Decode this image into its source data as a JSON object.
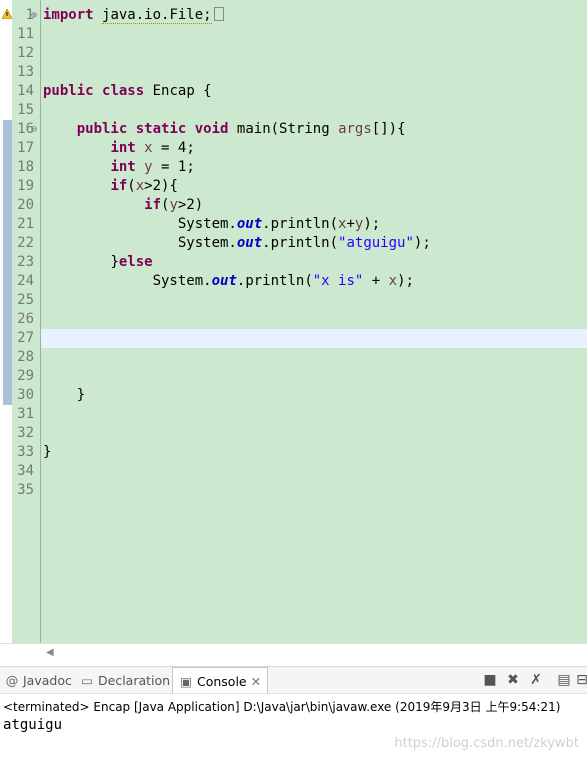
{
  "editor": {
    "line_numbers": [
      "1",
      "11",
      "12",
      "13",
      "14",
      "15",
      "16",
      "17",
      "18",
      "19",
      "20",
      "21",
      "22",
      "23",
      "24",
      "25",
      "26",
      "27",
      "28",
      "29",
      "30",
      "31",
      "32",
      "33",
      "34",
      "35"
    ],
    "code": {
      "l1_kw": "import",
      "l1_rest": "java.io.File;",
      "l14_kw1": "public",
      "l14_kw2": "class",
      "l14_rest": "Encap {",
      "l16_kw1": "public",
      "l16_kw2": "static",
      "l16_kw3": "void",
      "l16_a": "main(String",
      "l16_var": "args",
      "l16_b": "[]){",
      "l17_kw": "int",
      "l17_var": "x",
      "l17_rest": "= 4;",
      "l18_kw": "int",
      "l18_var": "y",
      "l18_rest": "= 1;",
      "l19_kw": "if",
      "l19_a": "(",
      "l19_var": "x",
      "l19_b": ">2){",
      "l20_kw": "if",
      "l20_a": "(",
      "l20_var": "y",
      "l20_b": ">2)",
      "l21_a": "System.",
      "l21_fld": "out",
      "l21_b": ".println(",
      "l21_v1": "x",
      "l21_c": "+",
      "l21_v2": "y",
      "l21_d": ");",
      "l22_a": "System.",
      "l22_fld": "out",
      "l22_b": ".println(",
      "l22_str": "\"atguigu\"",
      "l22_c": ");",
      "l23_a": "}",
      "l23_kw": "else",
      "l24_a": "System.",
      "l24_fld": "out",
      "l24_b": ".println(",
      "l24_str": "\"x is\"",
      "l24_c": " + ",
      "l24_var": "x",
      "l24_d": ");",
      "l30": "}",
      "l33": "}"
    }
  },
  "tabs": {
    "javadoc": "Javadoc",
    "declaration": "Declaration",
    "console": "Console"
  },
  "console": {
    "status": "<terminated> Encap [Java Application] D:\\Java\\jar\\bin\\javaw.exe (2019年9月3日 上午9:54:21)",
    "output": "atguigu"
  },
  "watermark": "https://blog.csdn.net/zkywbt",
  "colors": {
    "editor_bg": "#cce8cf",
    "keyword": "#7f0055",
    "string": "#2a00ff",
    "field": "#0000c0"
  }
}
